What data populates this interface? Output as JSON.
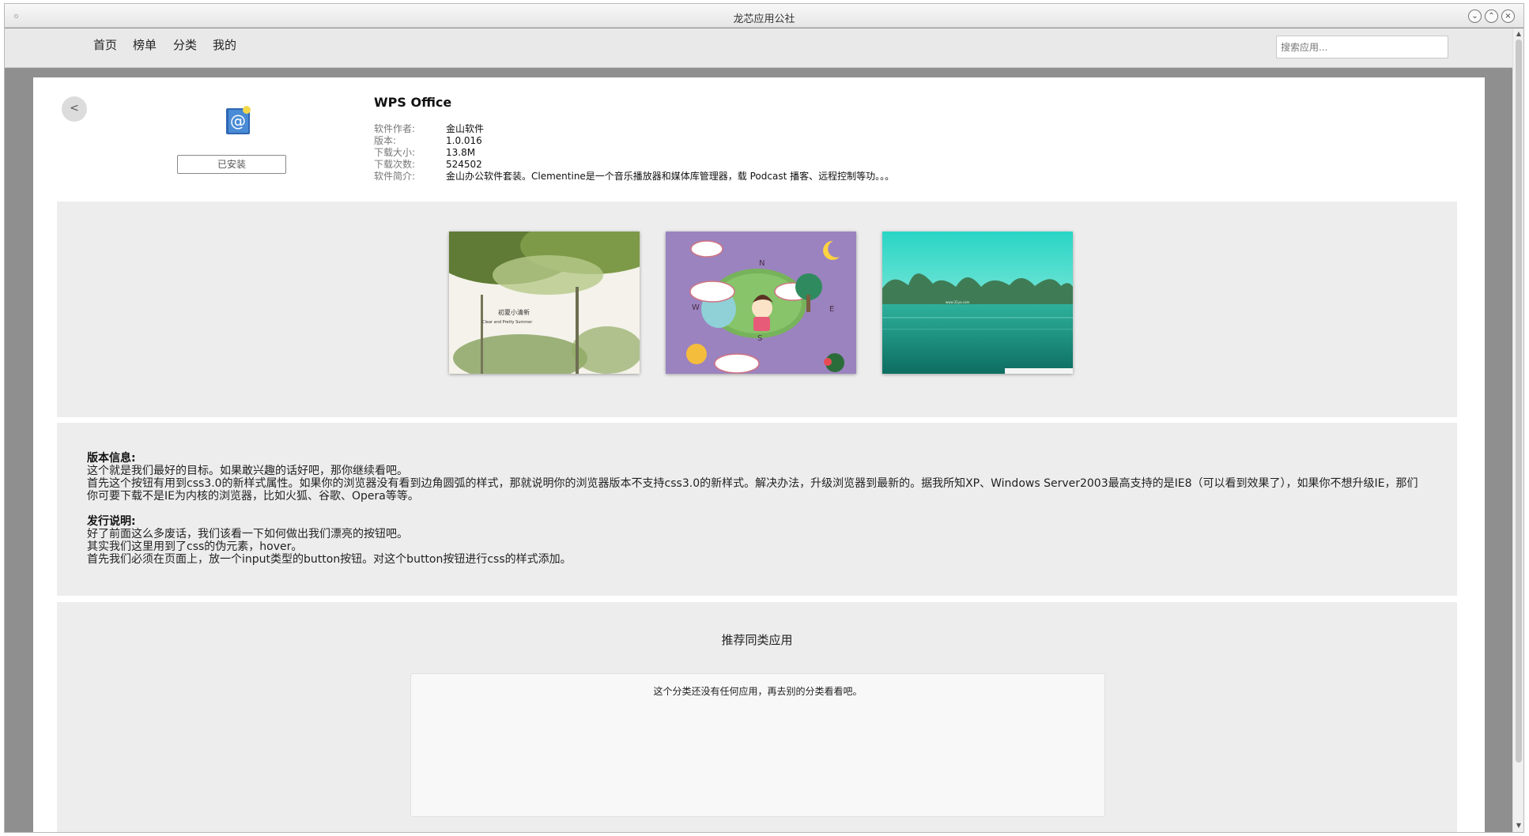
{
  "window": {
    "title": "龙芯应用公社",
    "controls": {
      "minimize": "⌄",
      "maximize": "⌃",
      "close": "×"
    }
  },
  "nav": {
    "items": [
      {
        "label": "首页"
      },
      {
        "label": "榜单"
      },
      {
        "label": "分类"
      },
      {
        "label": "我的"
      }
    ],
    "search_placeholder": "搜索应用..."
  },
  "app": {
    "back_label": "<",
    "icon": "mail-at-icon",
    "installed_label": "已安装",
    "name": "WPS Office",
    "details": [
      {
        "label": "软件作者:",
        "value": "金山软件"
      },
      {
        "label": "版本:",
        "value": "1.0.016"
      },
      {
        "label": "下载大小:",
        "value": "13.8M"
      },
      {
        "label": "下载次数:",
        "value": "524502"
      },
      {
        "label": "软件简介:",
        "value": "金山办公软件套装。Clementine是一个音乐播放器和媒体库管理器，载 Podcast 播客、远程控制等功。。。"
      }
    ]
  },
  "screenshots": {
    "items": [
      {
        "icon": "nature-leaves-screenshot",
        "caption": "初夏小清新",
        "caption_en": "Clear and Pretty Summer"
      },
      {
        "icon": "cartoon-compass-screenshot",
        "letters": {
          "n": "N",
          "e": "E",
          "w": "W",
          "s": "S"
        }
      },
      {
        "icon": "lake-mountains-screenshot",
        "watermark": "www.31ya.com"
      }
    ]
  },
  "description": {
    "version_heading": "版本信息:",
    "version_lines": [
      "这个就是我们最好的目标。如果敢兴趣的话好吧，那你继续看吧。",
      "首先这个按钮有用到css3.0的新样式属性。如果你的浏览器没有看到边角圆弧的样式，那就说明你的浏览器版本不支持css3.0的新样式。解决办法，升级浏览器到最新的。据我所知XP、Windows Server2003最高支持的是IE8（可以看到效果了），如果你不想升级IE，那们你可要下载不是IE为内核的浏览器，比如火狐、谷歌、Opera等等。"
    ],
    "release_heading": "发行说明:",
    "release_lines": [
      "好了前面这么多废话，我们该看一下如何做出我们漂亮的按钮吧。",
      "其实我们这里用到了css的伪元素，hover。",
      "首先我们必须在页面上，放一个input类型的button按钮。对这个button按钮进行css的样式添加。"
    ]
  },
  "related": {
    "title": "推荐同类应用",
    "empty_message": "这个分类还没有任何应用，再去别的分类看看吧。"
  },
  "scrollbar": {
    "up": "▲",
    "down": "▼"
  }
}
